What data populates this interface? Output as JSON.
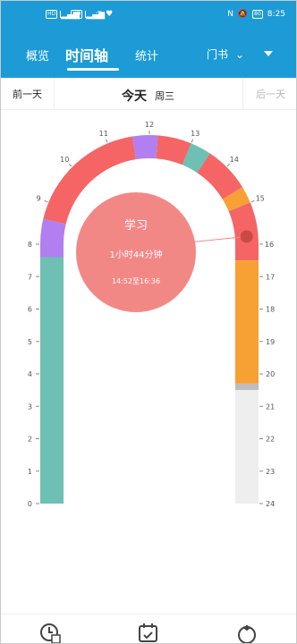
{
  "status": {
    "time": "8:25",
    "battery": "80"
  },
  "appbar": {
    "tabs": [
      "概览",
      "时间轴",
      "统计"
    ],
    "category": "门书"
  },
  "daynav": {
    "prev": "前一天",
    "title": "今天",
    "weekday": "周三",
    "next": "后一天"
  },
  "timeline": {
    "left_hours": [
      "0",
      "1",
      "2",
      "3",
      "4",
      "5",
      "6",
      "7",
      "8"
    ],
    "arc_hours": [
      "9",
      "10",
      "11",
      "12",
      "13",
      "14",
      "15",
      "16"
    ],
    "right_hours": [
      "17",
      "18",
      "19",
      "20",
      "21",
      "22",
      "23",
      "24"
    ],
    "segments": [
      {
        "start": 0,
        "end": 7.6,
        "color": "#6dc0b3"
      },
      {
        "start": 7.6,
        "end": 8.6,
        "color": "#b17ff0"
      },
      {
        "start": 8.6,
        "end": 11.6,
        "color": "#f56565"
      },
      {
        "start": 11.6,
        "end": 12.2,
        "color": "#b17ff0"
      },
      {
        "start": 12.2,
        "end": 13.0,
        "color": "#f56565"
      },
      {
        "start": 13.0,
        "end": 13.5,
        "color": "#6dc0b3"
      },
      {
        "start": 13.5,
        "end": 14.6,
        "color": "#f56565"
      },
      {
        "start": 14.6,
        "end": 15.0,
        "color": "#f7a034"
      },
      {
        "start": 15.0,
        "end": 16.5,
        "color": "#f56565"
      },
      {
        "start": 16.5,
        "end": 20.3,
        "color": "#f7a034"
      },
      {
        "start": 20.3,
        "end": 20.5,
        "color": "#bdbdbd"
      },
      {
        "start": 20.5,
        "end": 24,
        "color": "#eeeeee"
      }
    ],
    "detail": {
      "title": "学习",
      "duration": "1小时44分钟",
      "range": "14:52至16:36",
      "color": "#f28886"
    }
  },
  "bottom_nav": [
    {
      "icon": "clock-icon"
    },
    {
      "icon": "calendar-icon"
    },
    {
      "icon": "tomato-icon"
    }
  ]
}
